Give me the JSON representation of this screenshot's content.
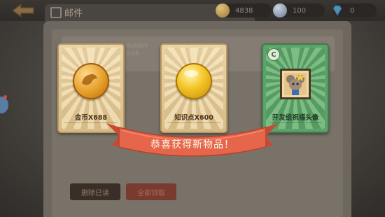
{
  "header": {
    "title": "邮件",
    "currencies": [
      {
        "icon": "gold-coin-icon",
        "value": "4838"
      },
      {
        "icon": "silver-coin-icon",
        "value": "100"
      },
      {
        "icon": "diamond-icon",
        "value": "0"
      }
    ]
  },
  "background_panel": {
    "item_text": "系统邮件",
    "item_sub": "2-08",
    "delete_read_label": "删除已读",
    "claim_all_label": "全部领取"
  },
  "rewards": {
    "banner_text": "恭喜获得新物品！",
    "items": [
      {
        "label": "金币X688",
        "icon": "gold-coin-icon"
      },
      {
        "label": "知识点X600",
        "icon": "knowledge-orb-icon"
      },
      {
        "label": "开发组祝福头像",
        "icon": "mouse-avatar-icon",
        "rarity": "C"
      }
    ]
  },
  "colors": {
    "card_paper": "#e2c896",
    "card_green": "#5ea36b",
    "ribbon": "#e5664b"
  }
}
